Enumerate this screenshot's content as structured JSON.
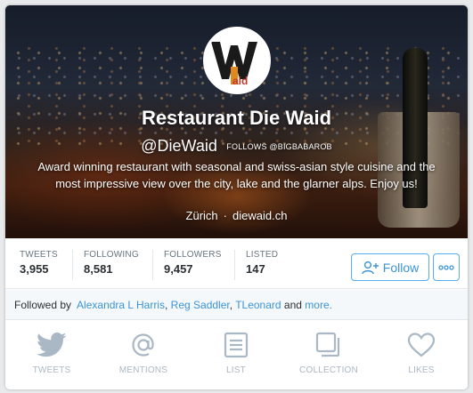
{
  "profile": {
    "name": "Restaurant Die Waid",
    "handle": "@DieWaid",
    "follows_you": "FOLLOWS @BIGBABAROB",
    "bio": "Award winning restaurant with seasonal and swiss-asian style cuisine and the most impressive view over the city, lake and the glarner alps. Enjoy us!",
    "location": "Zürich",
    "separator": "·",
    "website": "diewaid.ch",
    "avatar_letters": "W",
    "avatar_sub": "aid"
  },
  "stats": [
    {
      "label": "TWEETS",
      "value": "3,955"
    },
    {
      "label": "FOLLOWING",
      "value": "8,581"
    },
    {
      "label": "FOLLOWERS",
      "value": "9,457"
    },
    {
      "label": "LISTED",
      "value": "147"
    }
  ],
  "actions": {
    "follow_label": "Follow",
    "follow_icon": "add-user-icon",
    "more_icon": "more-dots-icon"
  },
  "followed_by": {
    "prefix": "Followed by",
    "users": [
      "Alexandra L Harris",
      "Reg Saddler",
      "TLeonard"
    ],
    "comma": ",",
    "and": "and",
    "more": "more."
  },
  "tabs": [
    {
      "label": "TWEETS",
      "icon": "twitter-bird-icon"
    },
    {
      "label": "MENTIONS",
      "icon": "at-icon"
    },
    {
      "label": "LIST",
      "icon": "list-icon"
    },
    {
      "label": "COLLECTION",
      "icon": "collection-icon"
    },
    {
      "label": "LIKES",
      "icon": "heart-icon"
    }
  ],
  "colors": {
    "accent": "#3b94d9",
    "tab_inactive": "#a9b8c4",
    "text": "#292f33",
    "muted": "#66757f"
  }
}
